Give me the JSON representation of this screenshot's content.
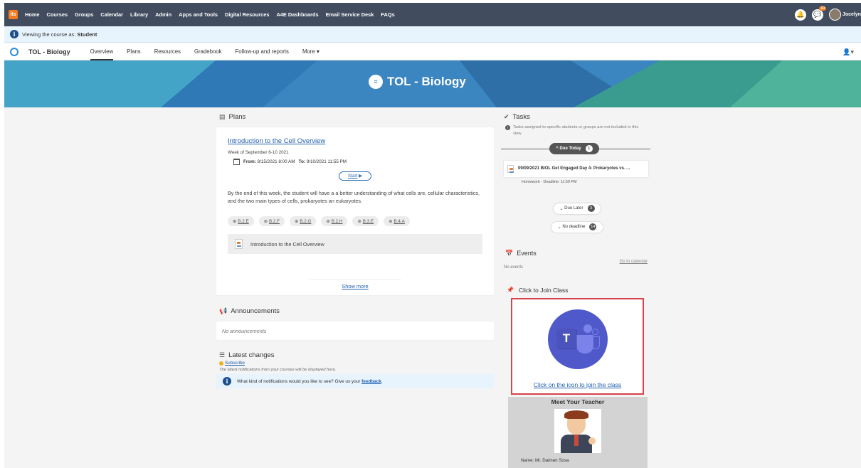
{
  "topnav": {
    "logo_text": "its",
    "items": [
      "Home",
      "Courses",
      "Groups",
      "Calendar",
      "Library",
      "Admin",
      "Apps and Tools",
      "Digital Resources",
      "A4E Dashboards",
      "Email Service Desk",
      "FAQs"
    ],
    "notif_badge": "10",
    "username": "Jocelyn"
  },
  "viewbar": {
    "prefix": "Viewing the course as:",
    "role": "Student"
  },
  "course": {
    "title": "TOL - Biology",
    "tabs": [
      "Overview",
      "Plans",
      "Resources",
      "Gradebook",
      "Follow-up and reports",
      "More"
    ]
  },
  "banner": {
    "title": "TOL - Biology"
  },
  "plans": {
    "heading": "Plans",
    "plan_title": "Introduction to the Cell Overview",
    "week": "Week of September 6-10 2021",
    "from_label": "From:",
    "from_value": "8/15/2021 8:00 AM",
    "to_label": "To:",
    "to_value": "9/10/2021 11:55 PM",
    "start_label": "Start",
    "description": "By the end of this week, the student will have a a better understanding of what cells are, cellular characteristics, and the two main types of cells, prokaryotes an eukaryotes.",
    "tags": [
      "B.2.E",
      "B.2.F",
      "B.2.G",
      "B.2.H",
      "B.3.E",
      "B.4.A"
    ],
    "resource_title": "Introduction to the Cell Overview",
    "show_more": "Show more"
  },
  "announcements": {
    "heading": "Announcements",
    "empty": "No announcements"
  },
  "latest": {
    "heading": "Latest changes",
    "subscribe": "Subscribe",
    "note": "The latest notifications from your courses will be displayed here.",
    "feedback_text": "What kind of notifications would you like to see? Give us your",
    "feedback_link": "feedback"
  },
  "tasks": {
    "heading": "Tasks",
    "note": "Tasks assigned to specific students or groups are not included in this view.",
    "due_today_label": "Due Today",
    "due_today_count": "1",
    "task_title": "09/09/2021 BIOL Get Engaged Day 4- Prokaryotes vs. ...",
    "task_meta": "Homework - Deadline: 11:59 PM",
    "due_later_label": "Due Later",
    "due_later_count": "3",
    "no_deadline_label": "No deadline",
    "no_deadline_count": "14"
  },
  "events": {
    "heading": "Events",
    "go_calendar": "Go to calendar",
    "empty": "No events"
  },
  "join": {
    "heading": "Click to Join Class",
    "link": "Click on the icon to join the class"
  },
  "teacher": {
    "heading": "Meet Your Teacher",
    "name": "Name: Mr. Daimen Sosa"
  }
}
